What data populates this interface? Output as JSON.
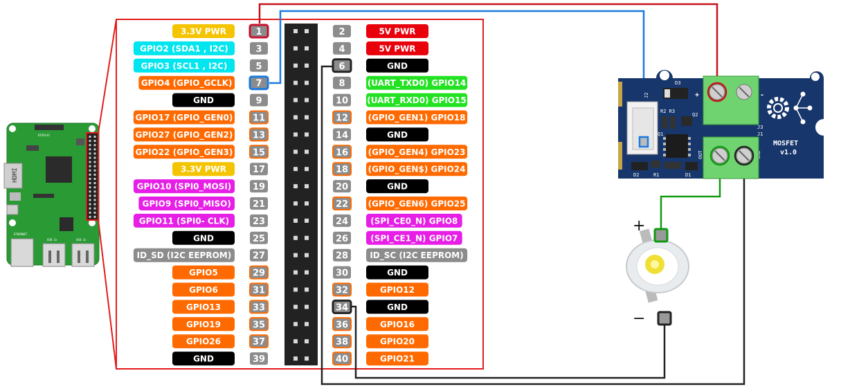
{
  "pins": [
    {
      "n": "1",
      "label": "3.3V PWR",
      "color": "#f5c400",
      "outline": "#c8102e"
    },
    {
      "n": "2",
      "label": "5V PWR",
      "color": "#e8000b"
    },
    {
      "n": "3",
      "label": "GPIO2 (SDA1 , I2C)",
      "color": "#00e5ee"
    },
    {
      "n": "4",
      "label": "5V PWR",
      "color": "#e8000b"
    },
    {
      "n": "5",
      "label": "GPIO3 (SCL1 , I2C)",
      "color": "#00e5ee"
    },
    {
      "n": "6",
      "label": "GND",
      "color": "#000000",
      "outline": "#222222"
    },
    {
      "n": "7",
      "label": "GPIO4 (GPIO_GCLK)",
      "color": "#ff6a00",
      "outline": "#1a7ae0"
    },
    {
      "n": "8",
      "label": "(UART_TXD0) GPIO14",
      "color": "#22e222"
    },
    {
      "n": "9",
      "label": "GND",
      "color": "#000000"
    },
    {
      "n": "10",
      "label": "(UART_RXD0) GPIO15",
      "color": "#22e222"
    },
    {
      "n": "11",
      "label": "GPIO17 (GPIO_GEN0)",
      "color": "#ff6a00"
    },
    {
      "n": "12",
      "label": "(GPIO_GEN1) GPIO18",
      "color": "#ff6a00"
    },
    {
      "n": "13",
      "label": "GPIO27 (GPIO_GEN2)",
      "color": "#ff6a00"
    },
    {
      "n": "14",
      "label": "GND",
      "color": "#000000"
    },
    {
      "n": "15",
      "label": "GPIO22 (GPIO_GEN3)",
      "color": "#ff6a00"
    },
    {
      "n": "16",
      "label": "(GPIO_GEN4) GPIO23",
      "color": "#ff6a00"
    },
    {
      "n": "17",
      "label": "3.3V PWR",
      "color": "#f5c400"
    },
    {
      "n": "18",
      "label": "(GPIO_GEN$) GPIO24",
      "color": "#ff6a00"
    },
    {
      "n": "19",
      "label": "GPIO10 (SPI0_MOSI)",
      "color": "#e61ee6"
    },
    {
      "n": "20",
      "label": "GND",
      "color": "#000000"
    },
    {
      "n": "21",
      "label": "GPIO9 (SPI0_MISO)",
      "color": "#e61ee6"
    },
    {
      "n": "22",
      "label": "(GPIO_GEN6) GPIO25",
      "color": "#ff6a00"
    },
    {
      "n": "23",
      "label": "GPIO11 (SPI0- CLK)",
      "color": "#e61ee6"
    },
    {
      "n": "24",
      "label": "(SPI_CE0_N) GPIO8",
      "color": "#e61ee6"
    },
    {
      "n": "25",
      "label": "GND",
      "color": "#000000"
    },
    {
      "n": "26",
      "label": "(SPI_CE1_N) GPIO7",
      "color": "#e61ee6"
    },
    {
      "n": "27",
      "label": "ID_SD (I2C EEPROM)",
      "color": "#8c8c8c"
    },
    {
      "n": "28",
      "label": "ID_SC (I2C EEPROM)",
      "color": "#8c8c8c"
    },
    {
      "n": "29",
      "label": "GPIO5",
      "color": "#ff6a00"
    },
    {
      "n": "30",
      "label": "GND",
      "color": "#000000"
    },
    {
      "n": "31",
      "label": "GPIO6",
      "color": "#ff6a00"
    },
    {
      "n": "32",
      "label": "GPIO12",
      "color": "#ff6a00"
    },
    {
      "n": "33",
      "label": "GPIO13",
      "color": "#ff6a00"
    },
    {
      "n": "34",
      "label": "GND",
      "color": "#000000",
      "outline": "#222222"
    },
    {
      "n": "35",
      "label": "GPIO19",
      "color": "#ff6a00"
    },
    {
      "n": "36",
      "label": "GPIO16",
      "color": "#ff6a00"
    },
    {
      "n": "37",
      "label": "GPIO26",
      "color": "#ff6a00"
    },
    {
      "n": "38",
      "label": "GPIO20",
      "color": "#ff6a00"
    },
    {
      "n": "39",
      "label": "GND",
      "color": "#000000"
    },
    {
      "n": "40",
      "label": "GPIO21",
      "color": "#ff6a00"
    }
  ],
  "mosfet": {
    "name": "MOSFET",
    "version": "v1.0",
    "j2": "J2",
    "j3": "J3",
    "j1": "J1",
    "d3": "D3",
    "d2": "D2",
    "d1": "D1",
    "r1": "R1",
    "r2r3": "R2 R3",
    "q2": "Q2",
    "q1": "Q1",
    "out": "OUT",
    "gnd": "GND",
    "plus": "+",
    "minus": "-"
  },
  "led": {
    "plus": "+",
    "minus": "−"
  },
  "colors": {
    "pcb_green": "#2a9a35",
    "header_red": "#e31b1b",
    "wire_red": "#c4121a",
    "wire_blue": "#1a7ae0",
    "wire_green": "#119911",
    "wire_black": "#222222",
    "mosfet_blue": "#17366b",
    "terminal_green": "#6fd36f"
  },
  "icons": {
    "mosfet_logo": "gear-icon",
    "led": "led-icon"
  }
}
